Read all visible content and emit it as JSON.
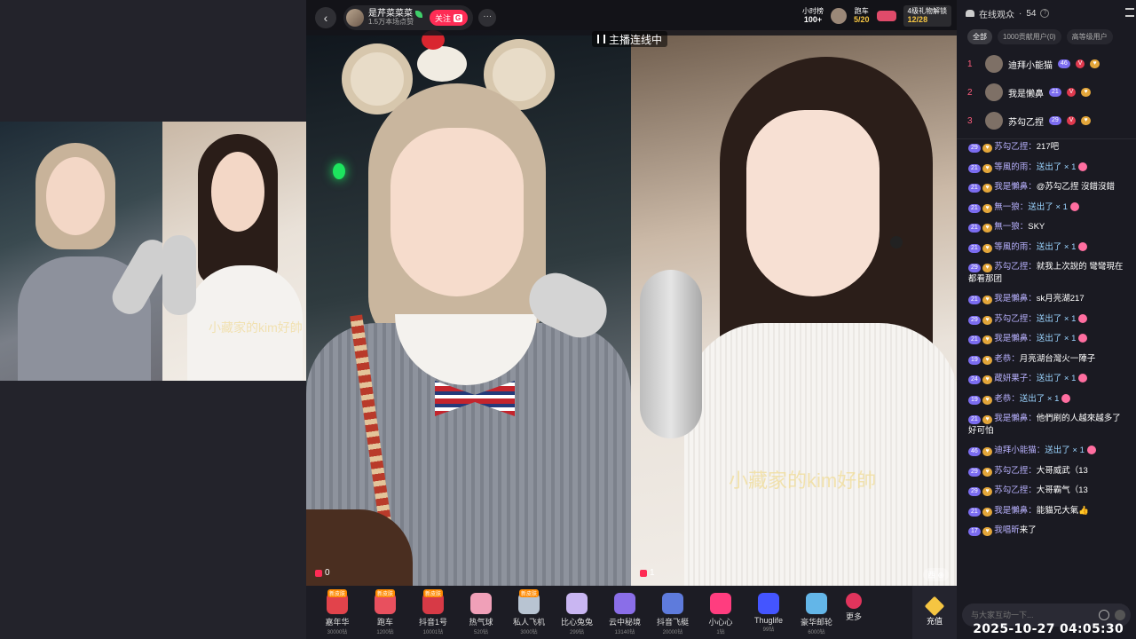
{
  "mini": {
    "watermark": "小藏家的kim好帥"
  },
  "topbar": {
    "anchor_name": "是芹菜菜菜",
    "anchor_sub": "1.5万本场点赞",
    "follow_label": "关注",
    "follow_badge": "G",
    "more": "···",
    "back": "‹"
  },
  "ranks": {
    "hour_label": "小时榜",
    "hour_value": "100+",
    "car_label": "跑车",
    "car_value": "5/20",
    "gift_label": "4级礼物解锁",
    "gift_value": "12/28"
  },
  "pk_badge": "主播连线中",
  "stage": {
    "watermark": "小藏家的kim好帥",
    "left_score": "0",
    "right_score": "1",
    "west_label": "西"
  },
  "gifts": {
    "items": [
      {
        "name": "嘉年华",
        "price": "30000钻",
        "new": "新皮肤",
        "color": "#e2434b"
      },
      {
        "name": "跑车",
        "price": "1200钻",
        "new": "新皮肤",
        "color": "#e8505e"
      },
      {
        "name": "抖音1号",
        "price": "10001钻",
        "new": "新皮肤",
        "color": "#d73a46"
      },
      {
        "name": "热气球",
        "price": "520钻",
        "new": "",
        "color": "#f0a0b8"
      },
      {
        "name": "私人飞机",
        "price": "3000钻",
        "new": "新皮肤",
        "color": "#b8c4d2"
      },
      {
        "name": "比心兔兔",
        "price": "299钻",
        "new": "",
        "color": "#c9b6f2"
      },
      {
        "name": "云中秘境",
        "price": "13140钻",
        "new": "",
        "color": "#8a6ee8"
      },
      {
        "name": "抖音飞艇",
        "price": "20000钻",
        "new": "",
        "color": "#5e7bdc"
      },
      {
        "name": "小心心",
        "price": "1钻",
        "new": "",
        "color": "#ff3d7f"
      },
      {
        "name": "Thuglife",
        "price": "99钻",
        "new": "",
        "color": "#4455ff"
      },
      {
        "name": "豪华邮轮",
        "price": "6000钻",
        "new": "",
        "color": "#63b6e8"
      }
    ],
    "more_label": "更多",
    "recharge_label": "充值"
  },
  "panel": {
    "title": "在线观众",
    "dot": "·",
    "count": "54",
    "tabs": [
      "全部",
      "1000贡献用户(0)",
      "高等级用户"
    ],
    "top3": [
      {
        "rank": "1",
        "name": "迪拜小能猫",
        "lv": "46"
      },
      {
        "rank": "2",
        "name": "我是懒鼻",
        "lv": "21"
      },
      {
        "rank": "3",
        "name": "苏勾乙捏",
        "lv": "29"
      }
    ],
    "messages": [
      {
        "lv": "29",
        "user": "苏勾乙捏：",
        "text": "217吧"
      },
      {
        "lv": "21",
        "user": "等風的雨：",
        "text": "送出了 × 1",
        "gift": true
      },
      {
        "lv": "21",
        "user": "我是懶鼻：",
        "text": "@苏勾乙捏 沒錯沒錯"
      },
      {
        "lv": "21",
        "user": "無一狼：",
        "text": "送出了 × 1",
        "gift": true
      },
      {
        "lv": "21",
        "user": "無一狼：",
        "text": "SKY"
      },
      {
        "lv": "21",
        "user": "等風的雨：",
        "text": "送出了 × 1",
        "gift": true
      },
      {
        "lv": "29",
        "user": "苏勾乙捏：",
        "text": "就我上次說的 彎彎現在都看那团"
      },
      {
        "lv": "21",
        "user": "我是懶鼻：",
        "text": "sk月亮湖217"
      },
      {
        "lv": "29",
        "user": "苏勾乙捏：",
        "text": "送出了 × 1",
        "gift": true
      },
      {
        "lv": "21",
        "user": "我是懶鼻：",
        "text": "送出了 × 1",
        "gift": true
      },
      {
        "lv": "19",
        "user": "老恭：",
        "text": "月亮湖台灣火一陣子"
      },
      {
        "lv": "24",
        "user": "蔵妍果子：",
        "text": "送出了 × 1",
        "gift": true
      },
      {
        "lv": "19",
        "user": "老恭：",
        "text": "送出了 × 1",
        "gift": true
      },
      {
        "lv": "21",
        "user": "我是懶鼻：",
        "text": "他們刷的人越來越多了 好可怕"
      },
      {
        "lv": "46",
        "user": "迪拜小能猫：",
        "text": "送出了 × 1",
        "gift": true
      },
      {
        "lv": "29",
        "user": "苏勾乙捏：",
        "text": "大哥威武（13"
      },
      {
        "lv": "29",
        "user": "苏勾乙捏：",
        "text": "大哥霸气（13"
      },
      {
        "lv": "21",
        "user": "我是懶鼻：",
        "text": "能貓兄大氣👍"
      },
      {
        "lv": "17",
        "user": "我唱昕",
        "text": "来了"
      }
    ],
    "input_placeholder": "与大家互动一下..."
  },
  "timestamp": "2025-10-27 04:05:30",
  "colors": {
    "accent": "#fe2c55",
    "panel_bg": "#1a1a22",
    "level": "#7b6cf0"
  }
}
